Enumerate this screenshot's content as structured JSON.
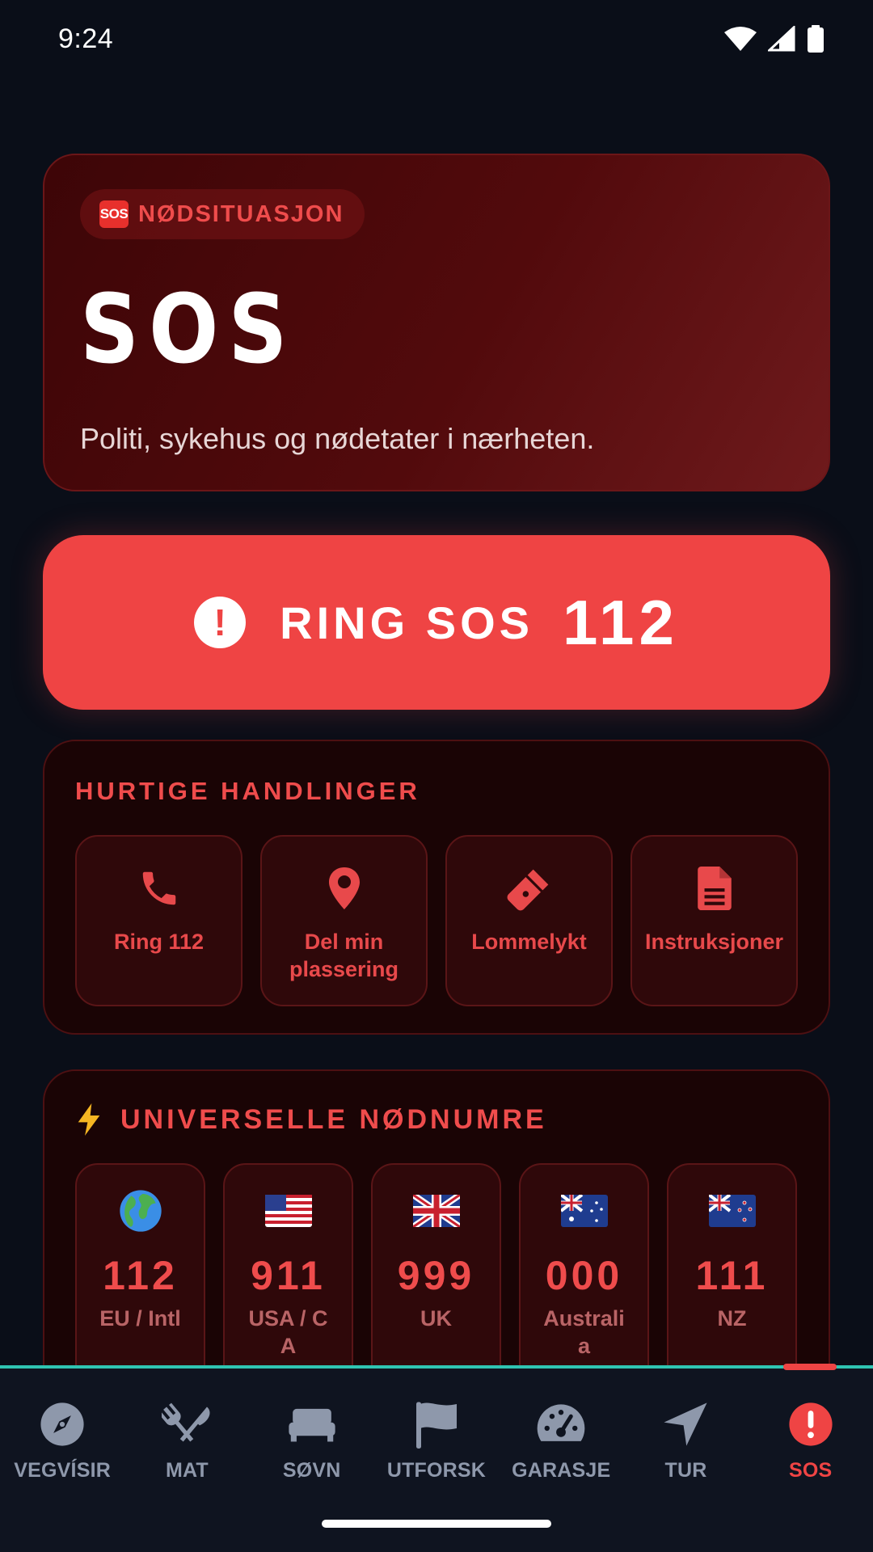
{
  "status_bar": {
    "time": "9:24"
  },
  "hero": {
    "badge_label": "NØDSITUASJON",
    "badge_emoji_text": "SOS",
    "title": "SOS",
    "subtitle": "Politi, sykehus og nødetater i nærheten."
  },
  "call_button": {
    "label": "RING SOS",
    "number": "112"
  },
  "quick_actions": {
    "heading": "HURTIGE HANDLINGER",
    "items": [
      {
        "label": "Ring 112",
        "icon": "phone-icon"
      },
      {
        "label": "Del min plassering",
        "icon": "location-pin-icon"
      },
      {
        "label": "Lommelykt",
        "icon": "flashlight-icon"
      },
      {
        "label": "Instruksjoner",
        "icon": "document-icon"
      }
    ]
  },
  "emergency_numbers": {
    "heading": "UNIVERSELLE NØDNUMRE",
    "heading_icon": "lightning-icon",
    "items": [
      {
        "number": "112",
        "region": "EU / Intl",
        "flag": "globe-icon"
      },
      {
        "number": "911",
        "region": "USA / CA",
        "flag": "us-flag-icon"
      },
      {
        "number": "999",
        "region": "UK",
        "flag": "uk-flag-icon"
      },
      {
        "number": "000",
        "region": "Australia",
        "flag": "australia-flag-icon"
      },
      {
        "number": "111",
        "region": "NZ",
        "flag": "nz-flag-icon"
      }
    ]
  },
  "bottom_nav": {
    "active": "SOS",
    "items": [
      {
        "label": "VEGVÍSIR",
        "icon": "compass-icon"
      },
      {
        "label": "MAT",
        "icon": "utensils-icon"
      },
      {
        "label": "SØVN",
        "icon": "bed-icon"
      },
      {
        "label": "UTFORSK",
        "icon": "flag-icon"
      },
      {
        "label": "GARASJE",
        "icon": "speedometer-icon"
      },
      {
        "label": "TUR",
        "icon": "navigation-arrow-icon"
      },
      {
        "label": "SOS",
        "icon": "alert-circle-icon"
      }
    ]
  },
  "colors": {
    "accent": "#ef4444",
    "background": "#0a0e18",
    "nav_divider": "#2fc4b2",
    "nav_inactive": "#8e98ab"
  }
}
